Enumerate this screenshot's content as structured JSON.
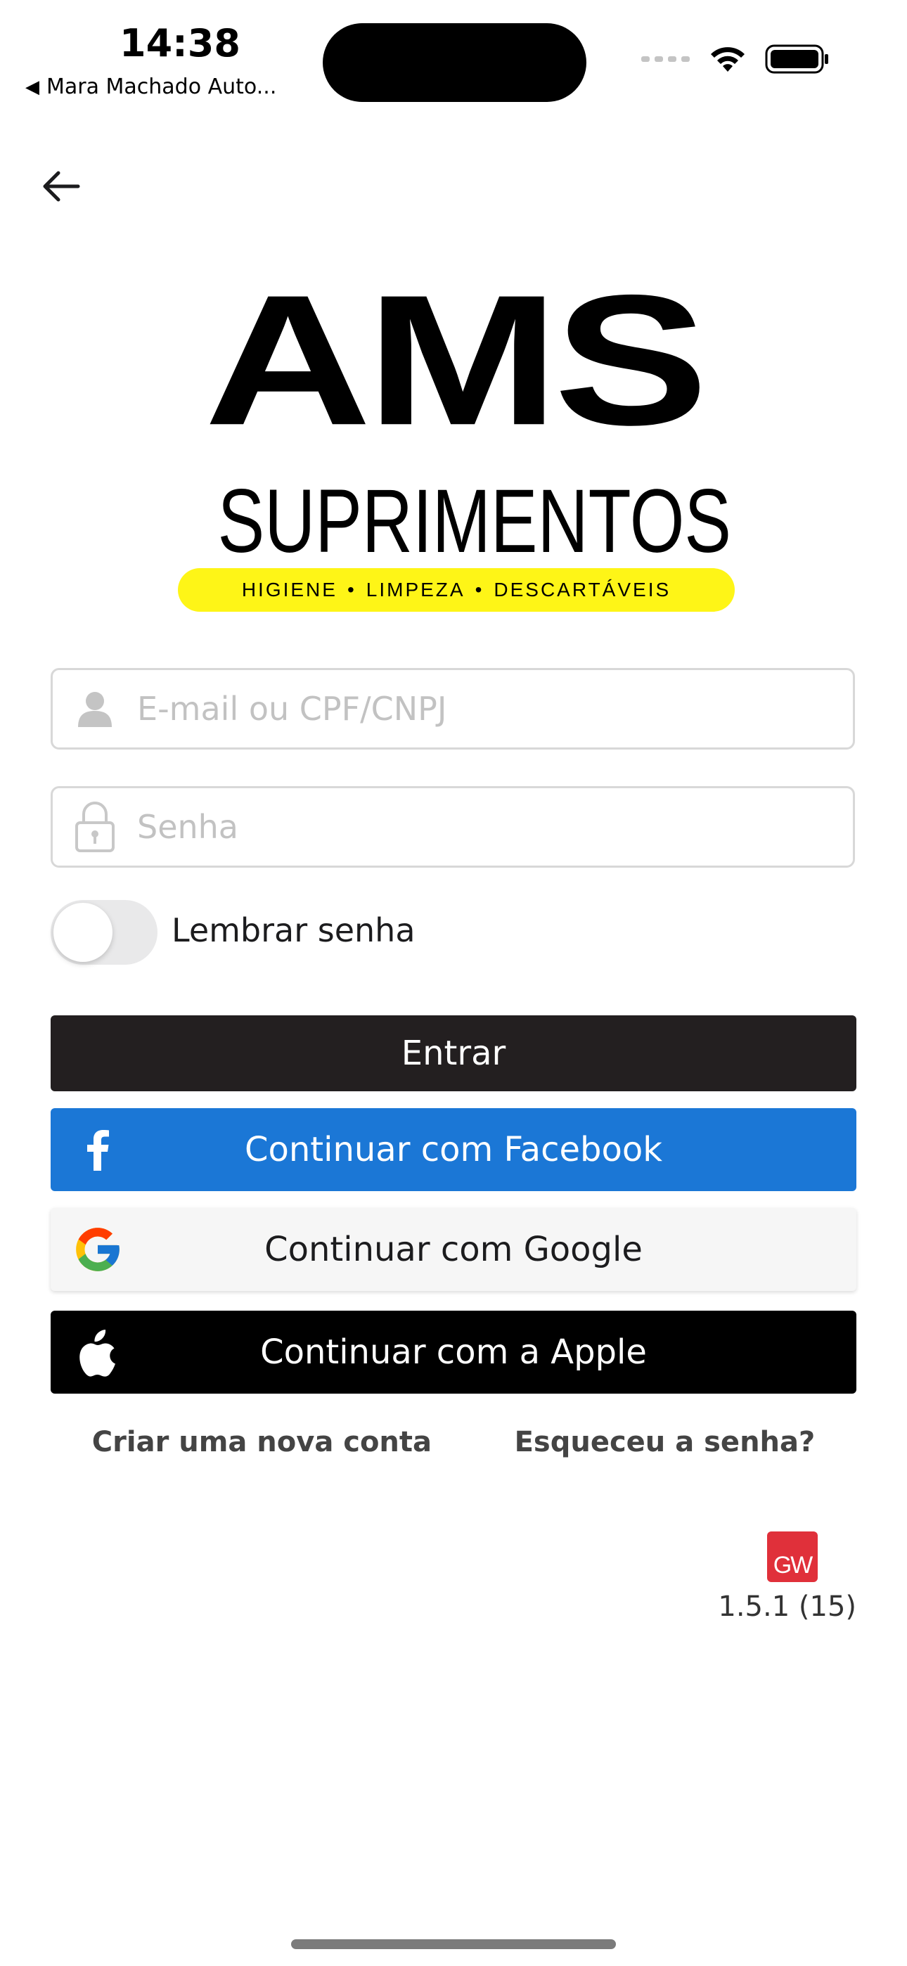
{
  "status_bar": {
    "time": "14:38",
    "back_app": "Mara Machado Auto..."
  },
  "logo": {
    "main": "AMS",
    "sub": "SUPRIMENTOS",
    "tagline": [
      "HIGIENE",
      "LIMPEZA",
      "DESCARTÁVEIS"
    ]
  },
  "form": {
    "login_placeholder": "E-mail ou CPF/CNPJ",
    "login_value": "",
    "password_placeholder": "Senha",
    "password_value": "",
    "remember_label": "Lembrar senha",
    "remember_on": false
  },
  "buttons": {
    "login": "Entrar",
    "facebook": "Continuar com Facebook",
    "google": "Continuar com Google",
    "apple": "Continuar com a Apple"
  },
  "links": {
    "create_account": "Criar uma nova conta",
    "forgot_password": "Esqueceu a senha?"
  },
  "footer": {
    "badge": "GW",
    "version": "1.5.1 (15)"
  },
  "colors": {
    "facebook": "#1b77d6",
    "login": "#231f20",
    "apple": "#000000",
    "logo_pill": "#fef517",
    "badge": "#e0303a"
  }
}
